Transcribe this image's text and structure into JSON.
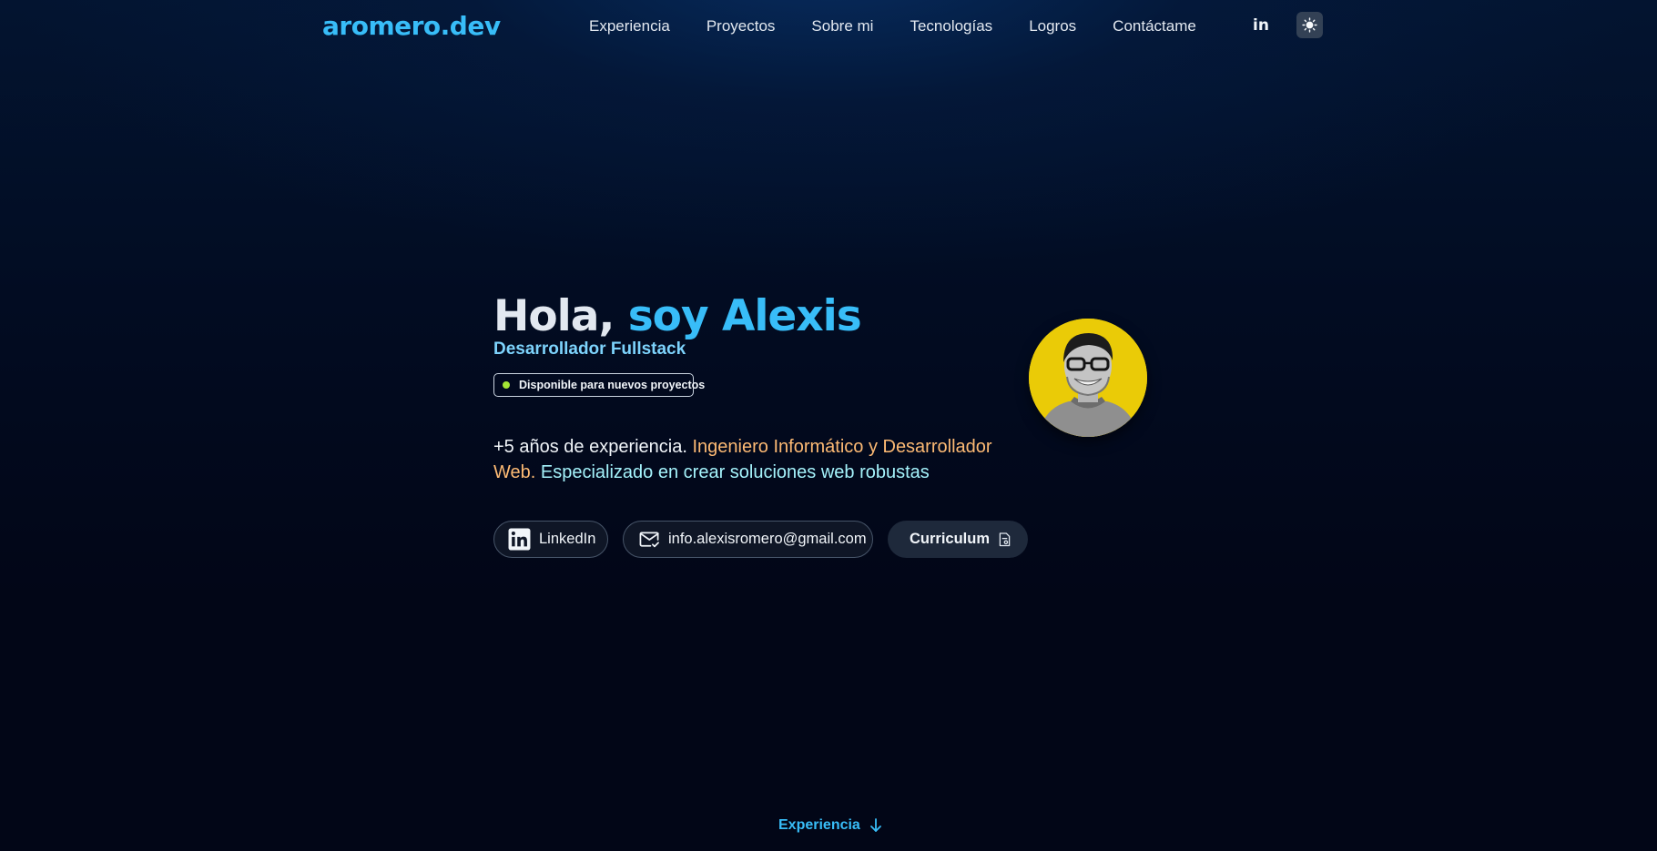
{
  "nav": {
    "logo": "aromero.dev",
    "links": [
      "Experiencia",
      "Proyectos",
      "Sobre mi",
      "Tecnologías",
      "Logros",
      "Contáctame"
    ],
    "linkedin_glyph": "in",
    "linkedin_icon": "linkedin-icon",
    "theme_icon": "sun-icon"
  },
  "hero": {
    "title_part1": "Hola,",
    "title_part2": "soy Alexis",
    "subtitle": "Desarrollador Fullstack",
    "badge": "Disponible para nuevos proyectos",
    "intro": {
      "part1": "+5 años de experiencia.",
      "part2": "Ingeniero Informático y Desarrollador Web.",
      "part3": "Especializado en crear soluciones web robustas"
    },
    "buttons": {
      "linkedin": "LinkedIn",
      "email": "info.alexisromero@gmail.com",
      "cv": "Curriculum"
    },
    "avatar_icon": "profile-photo"
  },
  "scroll_cue": {
    "label": "Experiencia",
    "icon": "arrow-down-icon"
  },
  "colors": {
    "accent": "#38bdf8",
    "background": "#020617",
    "highlight_orange": "#fdba74",
    "highlight_cyan": "#a5f3fc",
    "status_dot": "#a3e635",
    "avatar_bg": "#eacb07"
  }
}
